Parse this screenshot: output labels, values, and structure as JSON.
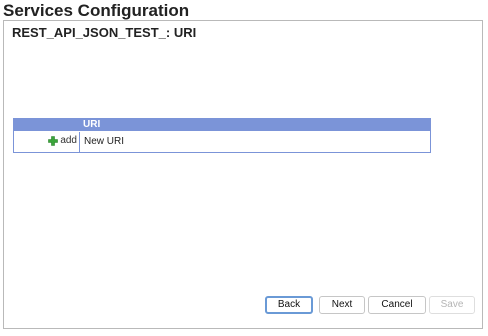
{
  "page": {
    "title": "Services Configuration"
  },
  "panel": {
    "title": "REST_API_JSON_TEST_: URI"
  },
  "uri_table": {
    "header": "URI",
    "rows": [
      {
        "action_label": "add",
        "action_icon": "plus-icon",
        "value": "New URI"
      }
    ]
  },
  "buttons": {
    "back": "Back",
    "next": "Next",
    "cancel": "Cancel",
    "save": "Save"
  },
  "colors": {
    "table_header": "#7b94d8",
    "add_icon": "#3aa53a",
    "focus_border": "#6a9ad6",
    "disabled_text": "#b5b5b5"
  }
}
